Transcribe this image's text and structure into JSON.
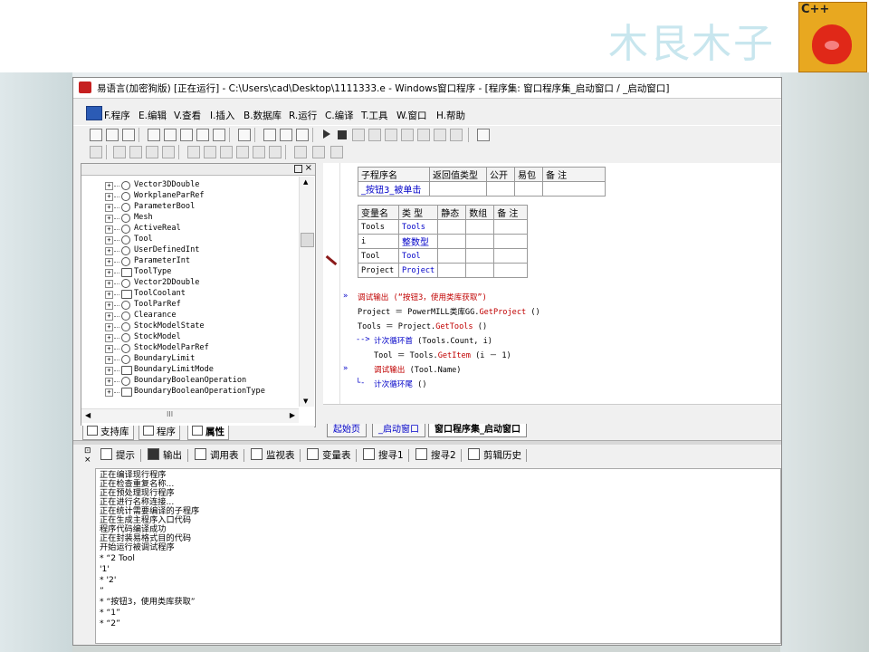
{
  "slide": {
    "watermark_title": "木艮木子",
    "logo_label": "C++"
  },
  "window": {
    "title": "易语言(加密狗版) [正在运行] - C:\\Users\\cad\\Desktop\\1111333.e - Windows窗口程序 - [程序集: 窗口程序集_启动窗口 / _启动窗口]"
  },
  "menu": [
    "F.程序",
    "E.编辑",
    "V.查看",
    "I.插入",
    "B.数据库",
    "R.运行",
    "C.编译",
    "T.工具",
    "W.窗口",
    "H.帮助"
  ],
  "tree_items": [
    "Vector3DDouble",
    "WorkplaneParRef",
    "ParameterBool",
    "Mesh",
    "ActiveReal",
    "Tool",
    "UserDefinedInt",
    "ParameterInt",
    "ToolType",
    "Vector2DDouble",
    "ToolCoolant",
    "ToolParRef",
    "Clearance",
    "StockModelState",
    "StockModel",
    "StockModelParRef",
    "BoundaryLimit",
    "BoundaryLimitMode",
    "BoundaryBooleanOperation",
    "BoundaryBooleanOperationType"
  ],
  "left_scroll_mid": "III",
  "left_tabs": [
    "支持库",
    "程序",
    "属性"
  ],
  "sub_table": {
    "headers": [
      "子程序名",
      "返回值类型",
      "公开",
      "易包",
      "备 注"
    ],
    "row": [
      "_按钮3_被单击",
      "",
      "",
      "",
      ""
    ]
  },
  "var_table": {
    "headers": [
      "变量名",
      "类 型",
      "静态",
      "数组",
      "备 注"
    ],
    "rows": [
      [
        "Tools",
        "Tools",
        "",
        "",
        ""
      ],
      [
        "i",
        "整数型",
        "",
        "",
        ""
      ],
      [
        "Tool",
        "Tool",
        "",
        "",
        ""
      ],
      [
        "Project",
        "Project",
        "",
        "",
        ""
      ]
    ]
  },
  "code": {
    "l1": "调试输出 (“按钮3，使用类库获取”)",
    "l2a": "Project ＝ PowerMILL类库GG.",
    "l2b": "GetProject",
    "l2c": " ()",
    "l3a": "Tools ＝ Project.",
    "l3b": "GetTools",
    "l3c": " ()",
    "l4a": "计次循环首",
    "l4b": " (Tools.Count, i)",
    "l5a": "Tool ＝ Tools.",
    "l5b": "GetItem",
    "l5c": " (i － 1)",
    "l6a": "调试输出",
    "l6b": " (Tool.Name)",
    "l7a": "计次循环尾",
    "l7b": " ()"
  },
  "editor_tabs": [
    "起始页",
    "_启动窗口",
    "窗口程序集_启动窗口"
  ],
  "output_tabs": [
    "提示",
    "输出",
    "调用表",
    "监视表",
    "变量表",
    "搜寻1",
    "搜寻2",
    "剪辑历史"
  ],
  "output_lines": [
    "正在编译现行程序",
    "正在检查重复名称...",
    "正在预处理现行程序",
    "正在进行名称连接...",
    "正在统计需要编译的子程序",
    "正在生成主程序入口代码",
    "程序代码编译成功",
    "正在封装易格式目的代码",
    "开始运行被调试程序",
    "* “2 Tool",
    "  '1'",
    "* '2'",
    "”",
    "* “按钮3，使用类库获取”",
    "* “1”",
    "* “2”"
  ],
  "colors": {
    "keyword_red": "#c00000",
    "type_blue": "#0000c8"
  }
}
